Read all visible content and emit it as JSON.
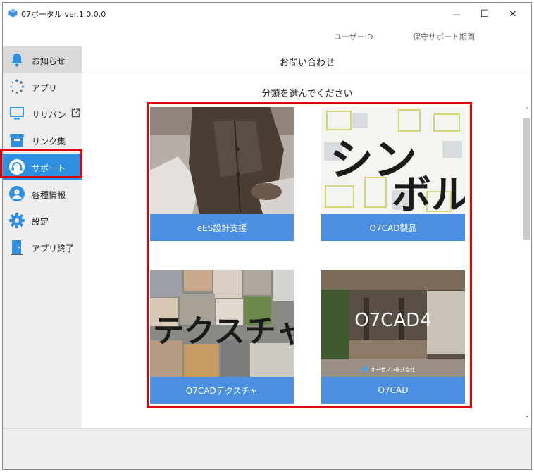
{
  "window": {
    "title": "07ポータル  ver.1.0.0.0",
    "min_glyph": "—",
    "max_glyph": "☐",
    "close_glyph": "✕"
  },
  "infobar": {
    "user_id_label": "ユーザーID",
    "support_period_label": "保守サポート期間"
  },
  "sidebar": {
    "items": [
      {
        "label": "お知らせ",
        "icon": "bell-icon"
      },
      {
        "label": "アプリ",
        "icon": "apps-dots-icon"
      },
      {
        "label": "サリバン",
        "icon": "monitor-icon"
      },
      {
        "label": "リンク集",
        "icon": "link-box-icon"
      },
      {
        "label": "サポート",
        "icon": "headset-icon"
      },
      {
        "label": "各種情報",
        "icon": "user-icon"
      },
      {
        "label": "設定",
        "icon": "gear-icon"
      },
      {
        "label": "アプリ終了",
        "icon": "exit-door-icon"
      }
    ],
    "active_index": 4,
    "active_color": "#2f8fe0"
  },
  "main": {
    "title": "お問い合わせ",
    "instruction": "分類を選んでください",
    "cards": [
      {
        "label": "eES設計支援"
      },
      {
        "label": "O7CAD製品",
        "thumb_text_1": "シン",
        "thumb_text_2": "ボル"
      },
      {
        "label": "O7CADテクスチャ",
        "thumb_text": "テクスチャ"
      },
      {
        "label": "O7CAD",
        "thumb_text": "O7CAD4",
        "thumb_sub": "オーセブン株式会社"
      }
    ],
    "caption_color": "#4a8fe2",
    "highlight_color": "#e30000"
  },
  "scrollbar": {
    "up_glyph": "˄",
    "down_glyph": "˅"
  }
}
